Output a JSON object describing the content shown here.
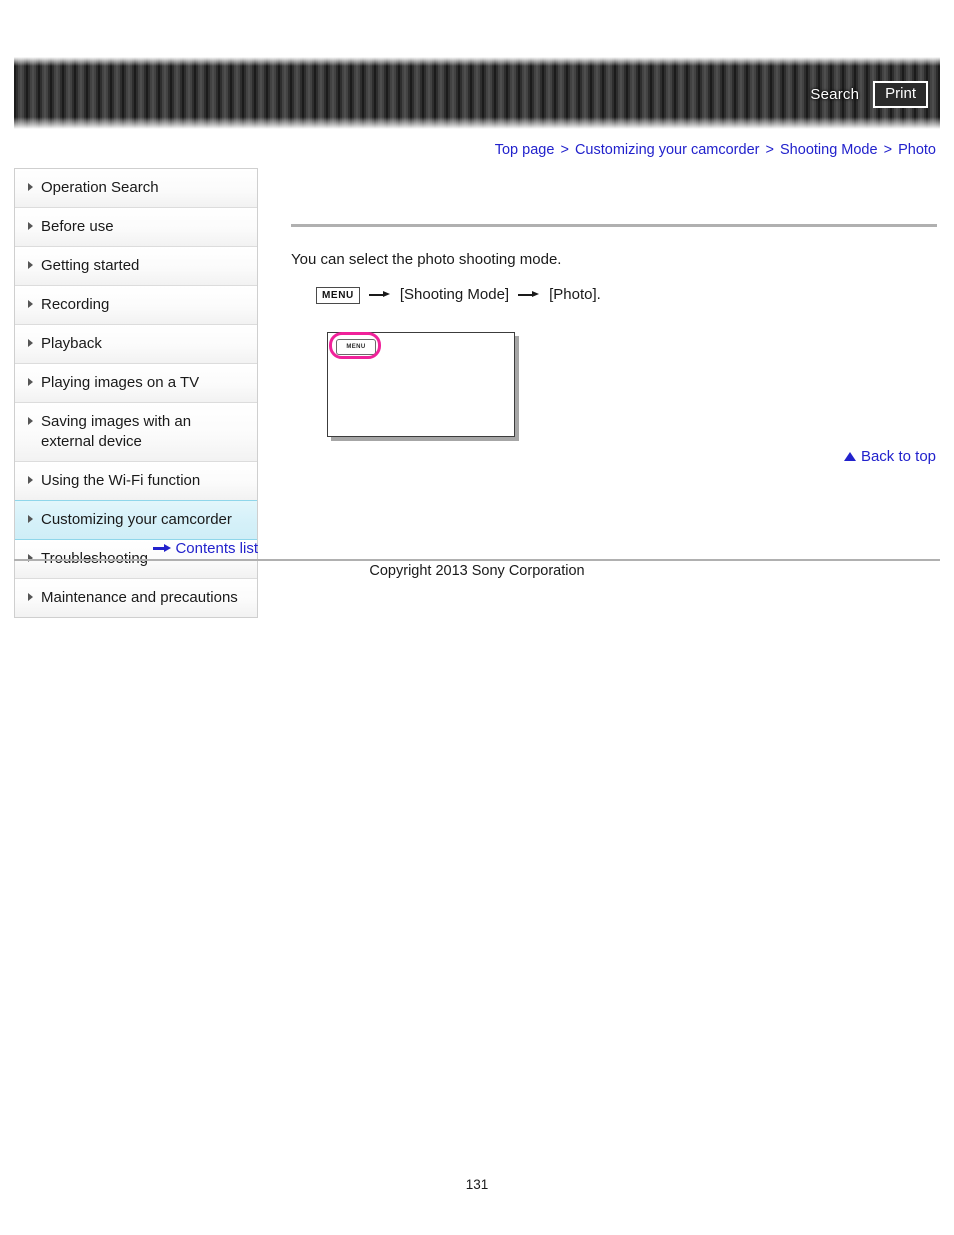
{
  "header": {
    "search_label": "Search",
    "print_label": "Print",
    "search_icon": "search-icon",
    "print_icon": "print-icon"
  },
  "breadcrumb": {
    "separator": ">",
    "items": [
      {
        "label": "Top page"
      },
      {
        "label": "Customizing your camcorder"
      },
      {
        "label": "Shooting Mode"
      },
      {
        "label": "Photo"
      }
    ]
  },
  "sidebar": {
    "items": [
      {
        "label": "Operation Search",
        "active": false
      },
      {
        "label": "Before use",
        "active": false
      },
      {
        "label": "Getting started",
        "active": false
      },
      {
        "label": "Recording",
        "active": false
      },
      {
        "label": "Playback",
        "active": false
      },
      {
        "label": "Playing images on a TV",
        "active": false
      },
      {
        "label": "Saving images with an external device",
        "active": false
      },
      {
        "label": "Using the Wi-Fi function",
        "active": false
      },
      {
        "label": "Customizing your camcorder",
        "active": true
      },
      {
        "label": "Troubleshooting",
        "active": false
      },
      {
        "label": "Maintenance and precautions",
        "active": false
      }
    ],
    "contents_list_label": "Contents list",
    "contents_list_icon": "arrow-right-icon",
    "bullet_icon": "triangle-right-icon"
  },
  "main": {
    "lead_text": "You can select the photo shooting mode.",
    "step": {
      "menu_chip": "MENU",
      "arrow_icon": "arrow-right-icon",
      "item_1": "[Shooting Mode]",
      "item_2": "[Photo]."
    },
    "figure": {
      "menu_button_label": "MENU",
      "highlight_color": "#f0229a"
    },
    "back_to_top_label": "Back to top",
    "back_to_top_icon": "triangle-up-icon"
  },
  "footer": {
    "copyright": "Copyright 2013 Sony Corporation",
    "page_number": "131"
  },
  "colors": {
    "link": "#2222cc",
    "active_nav_bg": "#d6f1f9",
    "active_nav_border": "#8fd6ea",
    "highlight_pink": "#f0229a",
    "rule_gray": "#b0b0b0"
  }
}
